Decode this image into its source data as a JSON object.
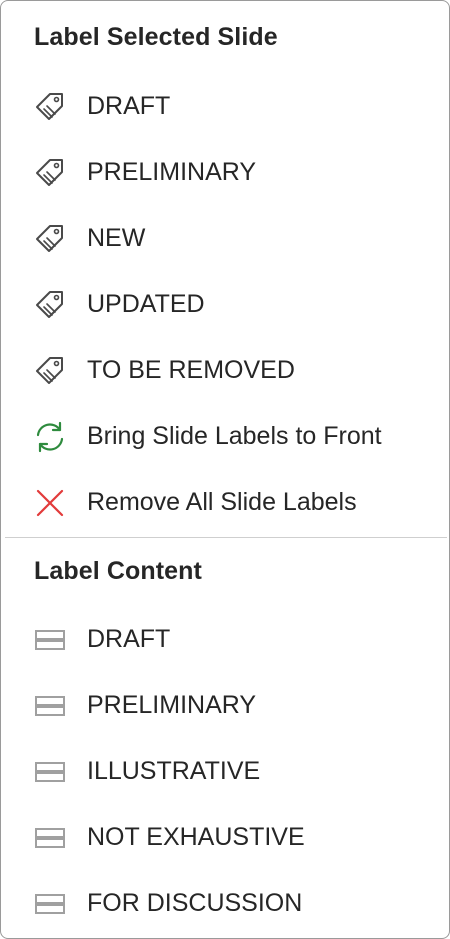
{
  "label_selected_slide": {
    "header": "Label Selected Slide",
    "items": [
      {
        "label": "DRAFT",
        "icon": "tag-icon"
      },
      {
        "label": "PRELIMINARY",
        "icon": "tag-icon"
      },
      {
        "label": "NEW",
        "icon": "tag-icon"
      },
      {
        "label": "UPDATED",
        "icon": "tag-icon"
      },
      {
        "label": "TO BE REMOVED",
        "icon": "tag-icon"
      },
      {
        "label": "Bring Slide Labels to Front",
        "icon": "refresh-icon"
      },
      {
        "label": "Remove All Slide Labels",
        "icon": "close-icon"
      }
    ]
  },
  "label_content": {
    "header": "Label Content",
    "items": [
      {
        "label": "DRAFT",
        "icon": "content-label-icon"
      },
      {
        "label": "PRELIMINARY",
        "icon": "content-label-icon"
      },
      {
        "label": "ILLUSTRATIVE",
        "icon": "content-label-icon"
      },
      {
        "label": "NOT EXHAUSTIVE",
        "icon": "content-label-icon"
      },
      {
        "label": "FOR DISCUSSION",
        "icon": "content-label-icon"
      }
    ]
  },
  "colors": {
    "refresh_icon": "#2e8b3e",
    "close_icon": "#e23b3b",
    "content_icon": "#a0a0a0",
    "tag_icon": "#4a4a4a"
  }
}
